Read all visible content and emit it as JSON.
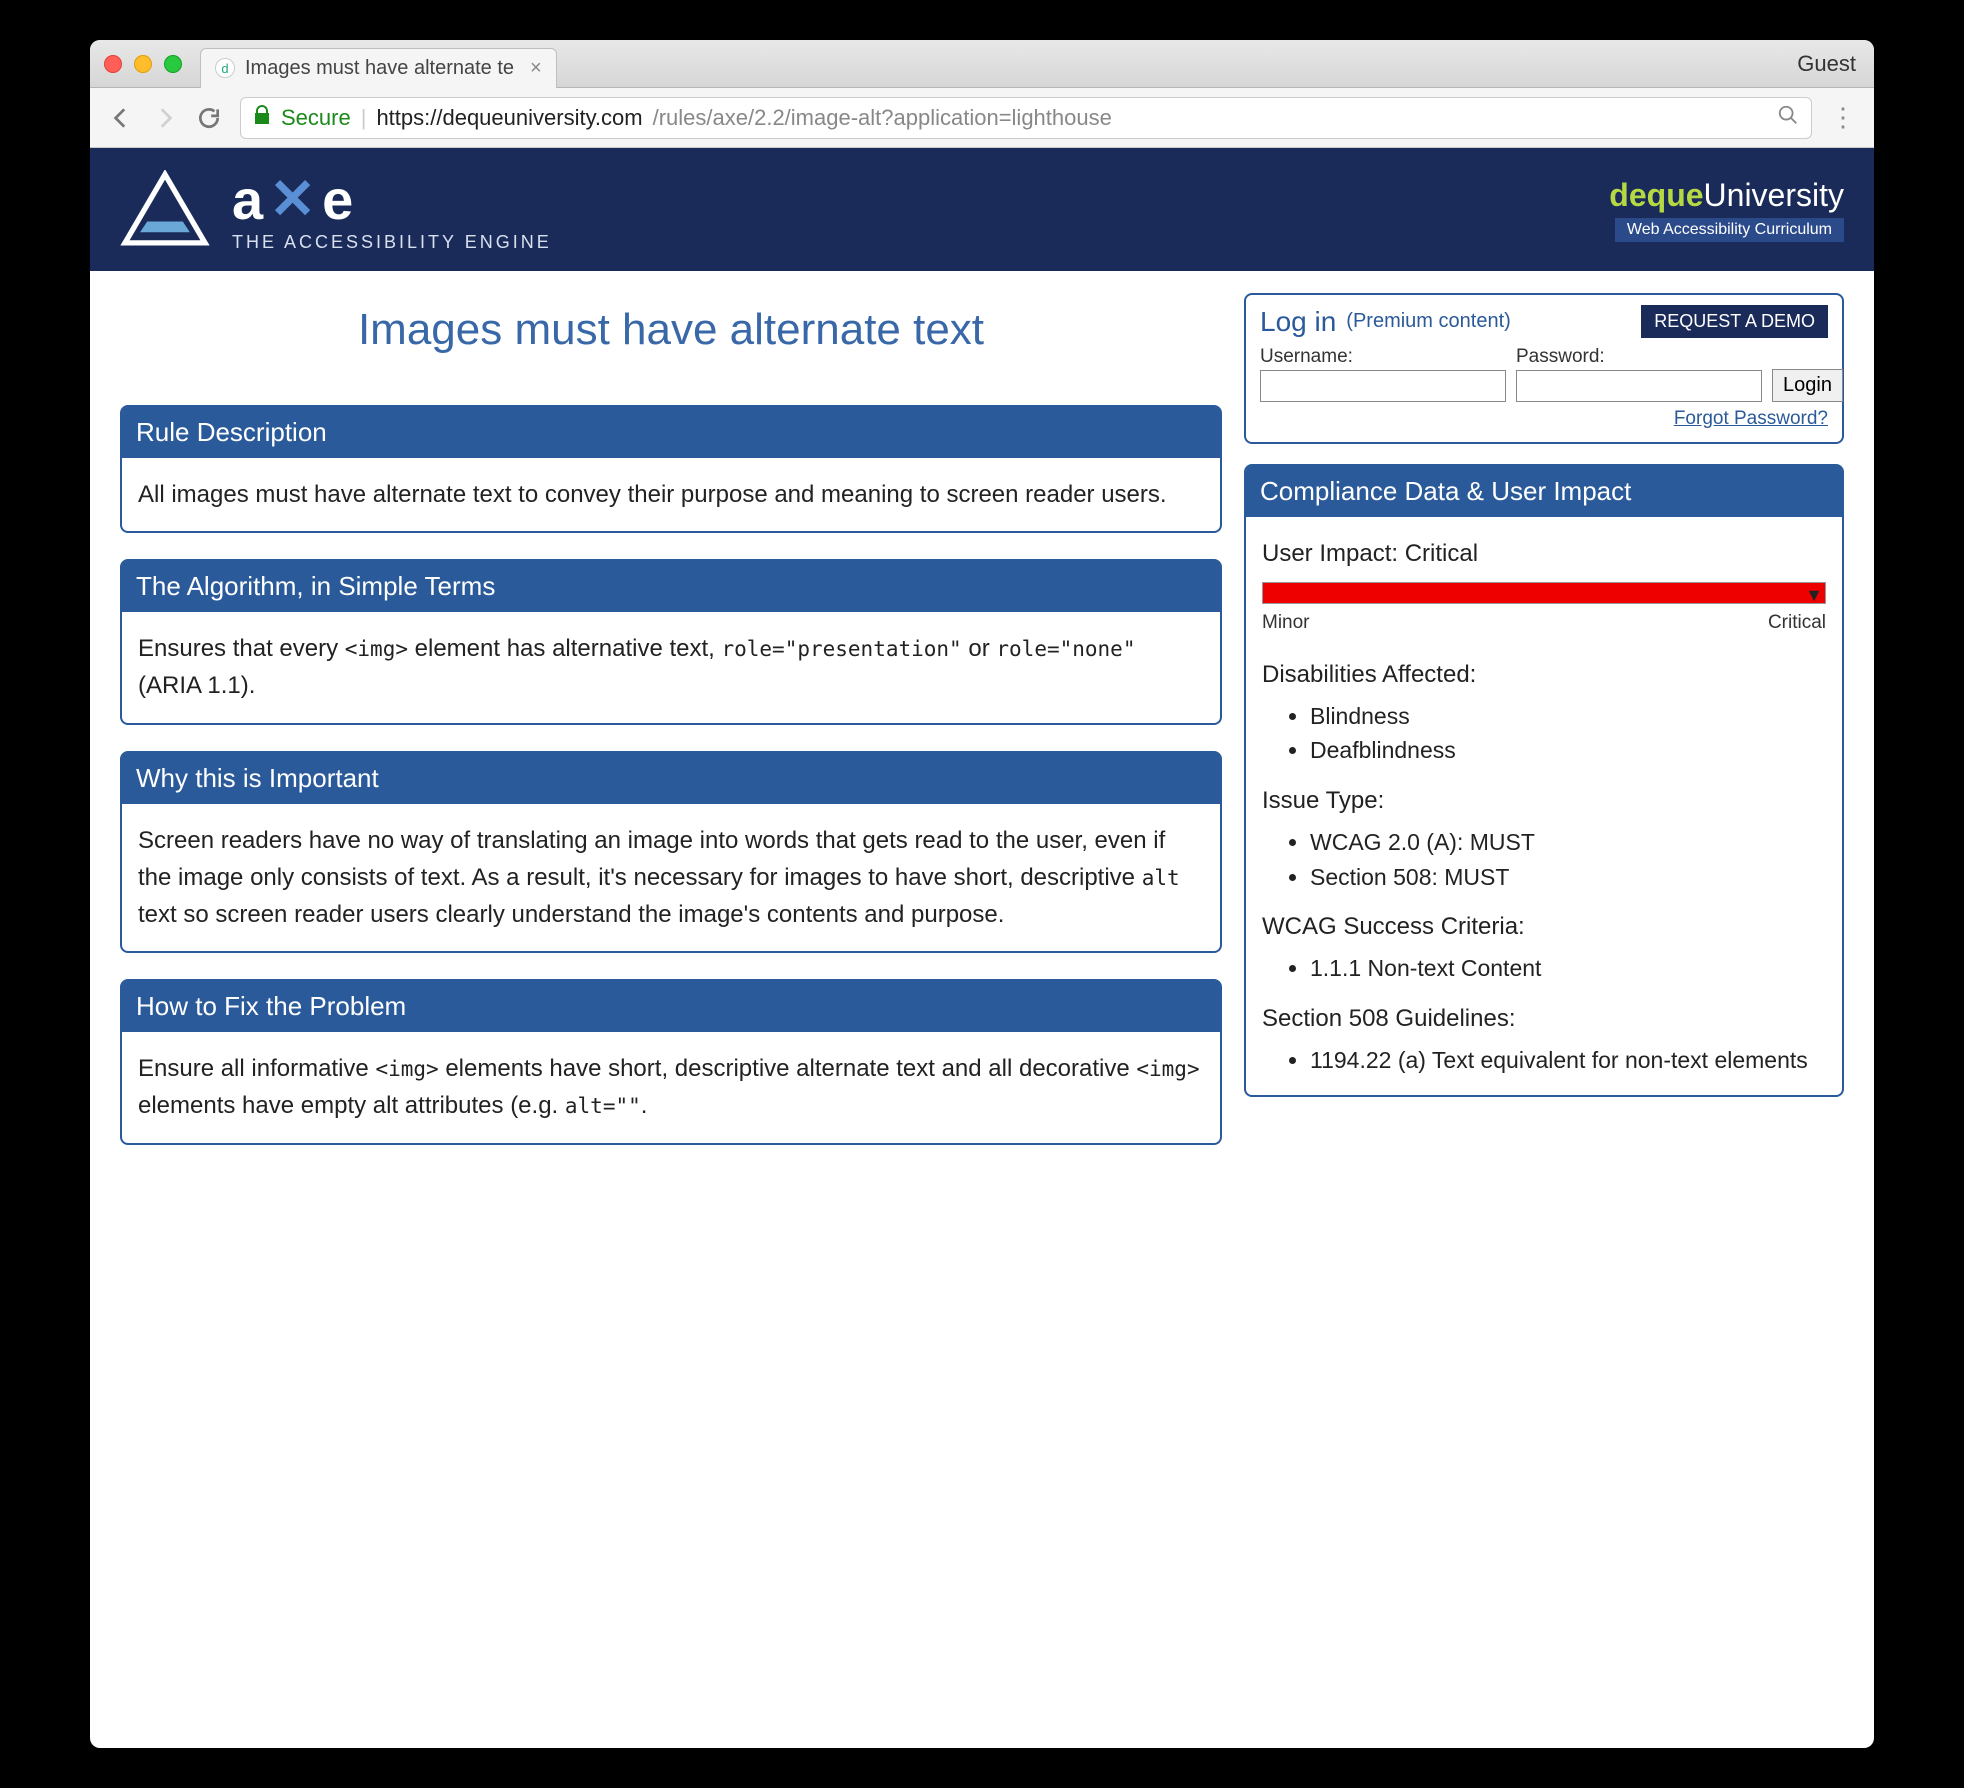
{
  "browser": {
    "tab_title": "Images must have alternate te",
    "guest": "Guest",
    "secure_label": "Secure",
    "url_host": "https://dequeuniversity.com",
    "url_path": "/rules/axe/2.2/image-alt?application=lighthouse"
  },
  "brand": {
    "name": "axe",
    "tagline": "THE ACCESSIBILITY ENGINE",
    "deque": "deque",
    "university": "University",
    "subtitle": "Web Accessibility Curriculum"
  },
  "page_title": "Images must have alternate text",
  "login": {
    "heading": "Log in",
    "premium": "(Premium content)",
    "demo": "REQUEST A DEMO",
    "username_label": "Username:",
    "password_label": "Password:",
    "login_btn": "Login",
    "forgot": "Forgot Password?"
  },
  "sections": {
    "rule_desc_h": "Rule Description",
    "rule_desc_b": "All images must have alternate text to convey their purpose and meaning to screen reader users.",
    "algo_h": "The Algorithm, in Simple Terms",
    "algo_b1": "Ensures that every ",
    "algo_c1": "<img>",
    "algo_b2": " element has alternative text, ",
    "algo_c2": "role=\"presentation\"",
    "algo_b3": " or ",
    "algo_c3": "role=\"none\"",
    "algo_b4": " (ARIA 1.1).",
    "why_h": "Why this is Important",
    "why_b1": "Screen readers have no way of translating an image into words that gets read to the user, even if the image only consists of text. As a result, it's necessary for images to have short, descriptive ",
    "why_c1": "alt",
    "why_b2": " text so screen reader users clearly understand the image's contents and purpose.",
    "fix_h": "How to Fix the Problem",
    "fix_b1": "Ensure all informative ",
    "fix_c1": "<img>",
    "fix_b2": " elements have short, descriptive alternate text and all decorative ",
    "fix_c2": "<img>",
    "fix_b3": " elements have empty alt attributes (e.g. ",
    "fix_c3": "alt=\"\"",
    "fix_b4": "."
  },
  "compliance": {
    "heading": "Compliance Data & User Impact",
    "impact_label": "User Impact:",
    "impact_value": "Critical",
    "meter_min": "Minor",
    "meter_max": "Critical",
    "disabilities_h": "Disabilities Affected:",
    "disabilities": [
      "Blindness",
      "Deafblindness"
    ],
    "issue_type_h": "Issue Type:",
    "issue_types": [
      "WCAG 2.0 (A): MUST",
      "Section 508: MUST"
    ],
    "wcag_h": "WCAG Success Criteria:",
    "wcag": [
      "1.1.1 Non-text Content"
    ],
    "s508_h": "Section 508 Guidelines:",
    "s508": [
      "1194.22 (a) Text equivalent for non-text elements"
    ]
  }
}
